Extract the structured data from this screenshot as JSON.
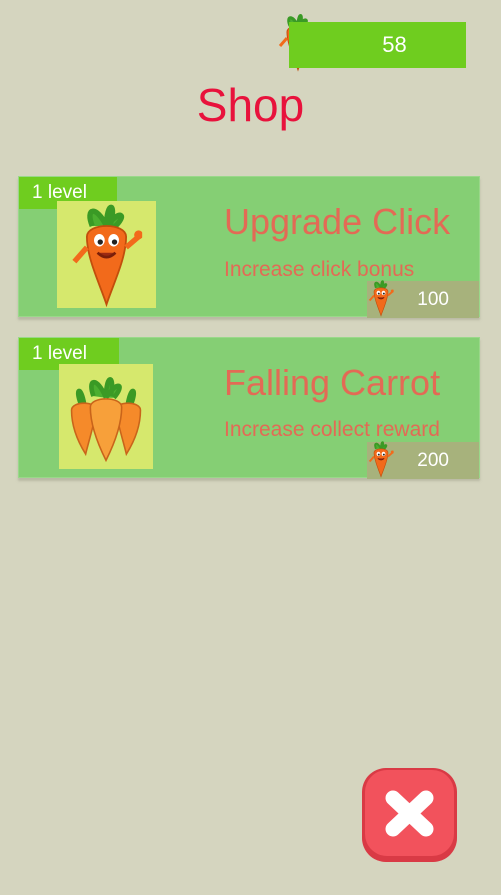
{
  "header": {
    "carrot_count": "58",
    "carrot_icon": "carrot-mascot-icon",
    "title": "Shop"
  },
  "shop": {
    "items": [
      {
        "level": "1 level",
        "title": "Upgrade Click",
        "description": "Increase click bonus",
        "price": "100",
        "image": "carrot-thumbs-up-image"
      },
      {
        "level": "1 level",
        "title": "Falling Carrot",
        "description": "Increase collect reward",
        "price": "200",
        "image": "carrot-bunch-image"
      }
    ]
  },
  "close_button": {
    "icon": "close-x-icon"
  },
  "colors": {
    "background": "#d5d5bf",
    "accent_green": "#6fcd1f",
    "card_green": "#85cf74",
    "title_red": "#e8123c",
    "text_coral": "#e36a55",
    "price_olive": "#a7b27c",
    "close_red": "#f2525c"
  }
}
